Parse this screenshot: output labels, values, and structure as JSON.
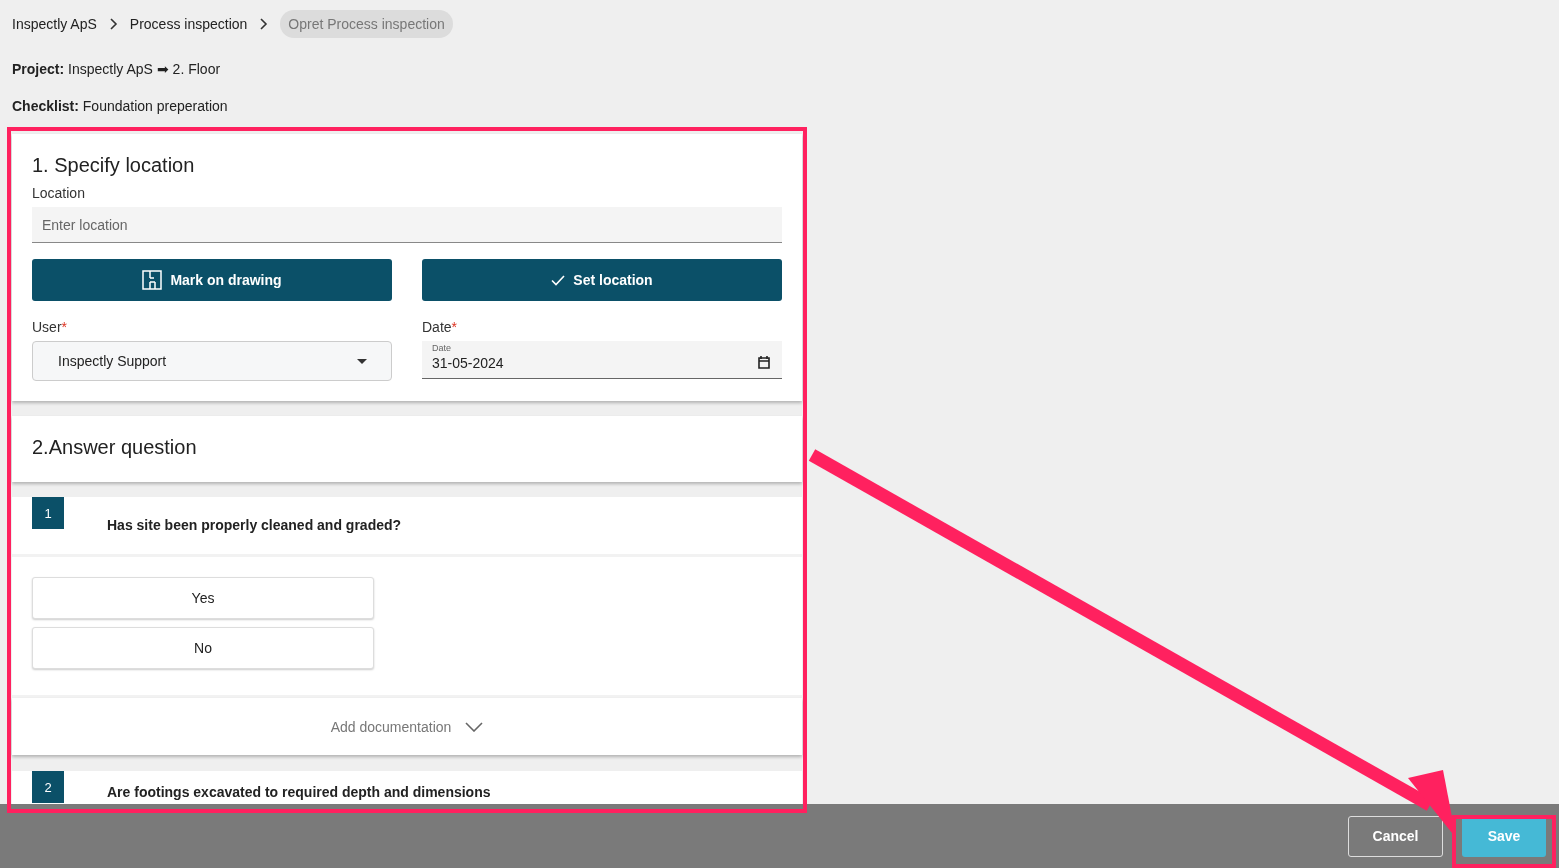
{
  "breadcrumbs": [
    {
      "label": "Inspectly ApS",
      "current": false
    },
    {
      "label": "Process inspection",
      "current": false
    },
    {
      "label": "Opret Process inspection",
      "current": true
    }
  ],
  "project": {
    "label": "Project:",
    "value": "Inspectly ApS ➡ 2. Floor"
  },
  "checklist": {
    "label": "Checklist:",
    "value": "Foundation preperation"
  },
  "location_section": {
    "title": "1. Specify location",
    "location_field": {
      "label": "Location",
      "placeholder": "Enter location"
    },
    "buttons": [
      {
        "label": "Mark on drawing",
        "kind": "drawing"
      },
      {
        "label": "Set location",
        "kind": "check"
      }
    ],
    "user": {
      "label": "User",
      "required_mark": "*",
      "value": "Inspectly Support"
    },
    "date": {
      "label": "Date",
      "required_mark": "*",
      "inner_label": "Date",
      "value": "31-05-2024"
    }
  },
  "question_section": {
    "title": "2.Answer question"
  },
  "questions": [
    {
      "number": "1",
      "text": "Has site been properly cleaned and graded?",
      "options": [
        "Yes",
        "No"
      ],
      "documentation": "Add documentation"
    },
    {
      "number": "2",
      "text": "Are footings excavated to required depth and dimensions"
    }
  ],
  "footer": {
    "buttons": [
      {
        "label": "Cancel",
        "kind": "outline"
      },
      {
        "label": "Save",
        "kind": "primary"
      }
    ]
  },
  "annotations": [
    {
      "kind": "frame"
    },
    {
      "kind": "arrow"
    },
    {
      "kind": "frame"
    }
  ]
}
